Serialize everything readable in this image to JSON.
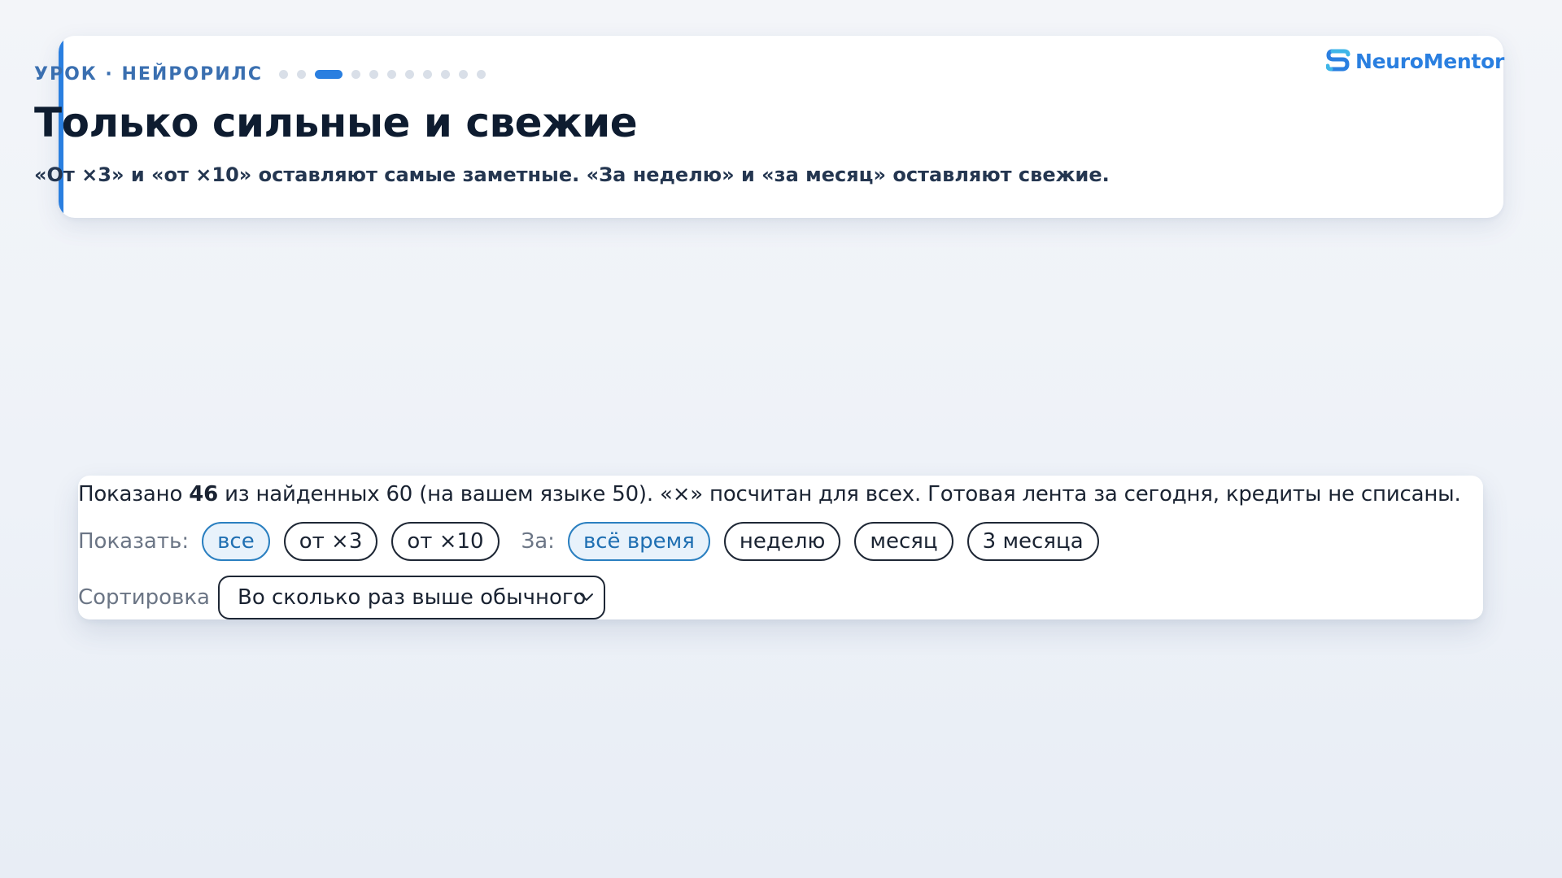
{
  "lesson": {
    "eyebrow": "УРОК · НЕЙРОРИЛС",
    "progress": {
      "current_step": 3,
      "total_steps": 11
    },
    "title": "Только сильные и свежие",
    "subtitle": "«От ×3» и «от ×10» оставляют самые заметные. «За неделю» и «за месяц» оставляют свежие."
  },
  "brand": {
    "name": "NeuroMentor",
    "icon": "neuromentor-logo",
    "color": "#2a7fe0"
  },
  "summary": {
    "prefix": "Показано ",
    "shown": "46",
    "suffix": " из найденных 60 (на вашем языке 50). «×» посчитан для всех. Готовая лента за сегодня, кредиты не списаны."
  },
  "filters": {
    "show_label": "Показать:",
    "show_options": [
      {
        "label": "все",
        "selected": true
      },
      {
        "label": "от ×3",
        "selected": false
      },
      {
        "label": "от ×10",
        "selected": false
      }
    ],
    "period_label": "За:",
    "period_options": [
      {
        "label": "всё время",
        "selected": true
      },
      {
        "label": "неделю",
        "selected": false
      },
      {
        "label": "месяц",
        "selected": false
      },
      {
        "label": "3 месяца",
        "selected": false
      }
    ],
    "sort_label": "Сортировка",
    "sort_value": "Во сколько раз выше обычного"
  },
  "colors": {
    "accent": "#2a7fe0",
    "selected_chip_bg": "#e8f2fb",
    "selected_chip_text": "#1f6fb2"
  }
}
